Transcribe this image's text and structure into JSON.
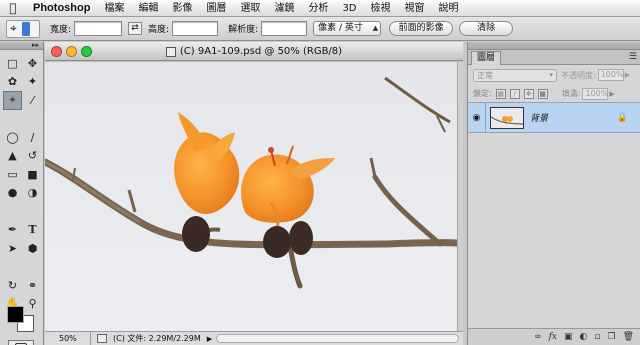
{
  "menubar": {
    "app_name": "Photoshop",
    "items": [
      "檔案",
      "編輯",
      "影像",
      "圖層",
      "選取",
      "濾鏡",
      "分析",
      "3D",
      "檢視",
      "視窗",
      "說明"
    ]
  },
  "options": {
    "width_label": "寬度:",
    "width_value": "",
    "height_label": "高度:",
    "height_value": "",
    "resolution_label": "解析度:",
    "resolution_value": "",
    "unit_select": "像素 / 英寸",
    "front_image_button": "前面的影像",
    "clear_button": "清除"
  },
  "document": {
    "title": "(C) 9A1-109.psd @ 50% (RGB/8)",
    "zoom": "50%",
    "status_text": "(C) 文件: 2.29M/2.29M",
    "window_colors": {
      "close": "#ff5f57",
      "minimize": "#febc2e",
      "zoom": "#28c840"
    }
  },
  "layers_panel": {
    "tab_label": "圖層",
    "blend_mode": "正常",
    "opacity_label": "不透明度:",
    "opacity_value": "100%",
    "lock_label": "鎖定:",
    "fill_label": "填滿:",
    "fill_value": "100%",
    "layers": [
      {
        "name": "背景",
        "locked": true,
        "visible": true
      }
    ]
  },
  "colors": {
    "foreground": "#000000",
    "background": "#ffffff",
    "layer_selected": "#b9d3f2"
  }
}
